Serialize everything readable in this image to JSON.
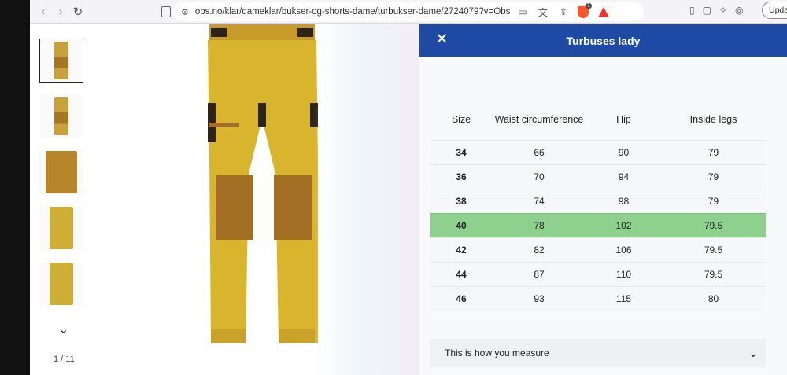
{
  "browser": {
    "url": "obs.no/klar/dameklar/bukser-og-shorts-dame/turbukser-dame/2724079?v=Obs-571...",
    "update_label": "Update",
    "brave_badge": "1"
  },
  "gallery": {
    "counter": "1 / 11"
  },
  "modal": {
    "title": "Turbuses lady",
    "columns": [
      "Size",
      "Waist circumference",
      "Hip",
      "Inside legs"
    ],
    "rows": [
      [
        "34",
        "66",
        "90",
        "79"
      ],
      [
        "36",
        "70",
        "94",
        "79"
      ],
      [
        "38",
        "74",
        "98",
        "79"
      ],
      [
        "40",
        "78",
        "102",
        "79.5"
      ],
      [
        "42",
        "82",
        "106",
        "79.5"
      ],
      [
        "44",
        "87",
        "110",
        "79.5"
      ],
      [
        "46",
        "93",
        "115",
        "80"
      ]
    ],
    "highlighted_size": "40",
    "measure_label": "This is how you measure"
  },
  "colors": {
    "modal_header": "#1e4aa5",
    "highlight": "#8ed08e",
    "pants_yellow": "#d9b52e",
    "pants_brown": "#a26f24"
  }
}
